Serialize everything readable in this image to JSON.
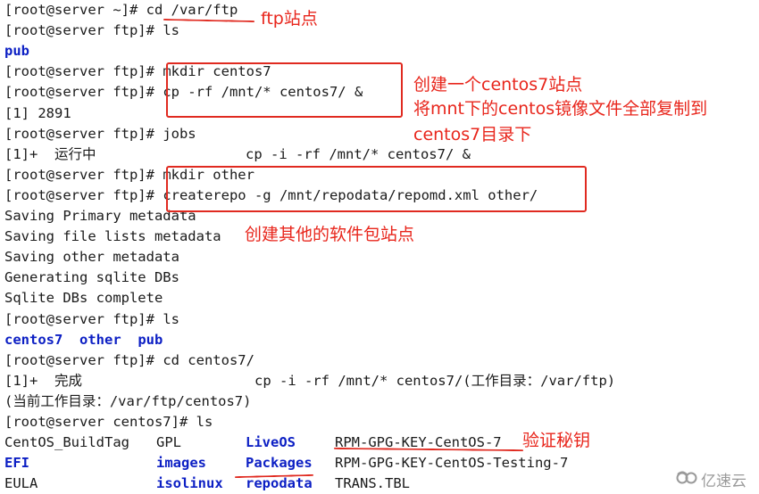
{
  "terminal": {
    "lines": [
      {
        "prompt": "[root@server ~]# ",
        "cmd": "cd /var/ftp"
      },
      {
        "prompt": "[root@server ftp]# ",
        "cmd": "ls"
      },
      {
        "output": "pub"
      },
      {
        "prompt": "[root@server ftp]# ",
        "cmd": "mkdir centos7"
      },
      {
        "prompt": "[root@server ftp]# ",
        "cmd": "cp -rf /mnt/* centos7/ &"
      },
      {
        "output": "[1] 2891"
      },
      {
        "prompt": "[root@server ftp]# ",
        "cmd": "jobs"
      },
      {
        "job_id": "[1]+  ",
        "job_state": "运行中",
        "job_cmd": "cp -i -rf /mnt/* centos7/ &"
      },
      {
        "prompt": "[root@server ftp]# ",
        "cmd": "mkdir other"
      },
      {
        "prompt": "[root@server ftp]# ",
        "cmd": "createrepo -g /mnt/repodata/repomd.xml other/"
      },
      {
        "output": "Saving Primary metadata"
      },
      {
        "output": "Saving file lists metadata"
      },
      {
        "output": "Saving other metadata"
      },
      {
        "output": "Generating sqlite DBs"
      },
      {
        "output": "Sqlite DBs complete"
      },
      {
        "prompt": "[root@server ftp]# ",
        "cmd": "ls"
      },
      {
        "dirs": [
          "centos7",
          "other",
          "pub"
        ]
      },
      {
        "prompt": "[root@server ftp]# ",
        "cmd": "cd centos7/"
      },
      {
        "job_id": "[1]+  ",
        "job_state": "完成",
        "job_cmd": "cp -i -rf /mnt/* centos7/(工作目录：/var/ftp)"
      },
      {
        "output": "(当前工作目录：/var/ftp/centos7)"
      },
      {
        "prompt": "[root@server centos7]# ",
        "cmd": "ls"
      }
    ],
    "listing": {
      "col1": [
        {
          "name": "CentOS_BuildTag",
          "dir": false
        },
        {
          "name": "EFI",
          "dir": true
        },
        {
          "name": "EULA",
          "dir": false
        }
      ],
      "col2": [
        {
          "name": "GPL",
          "dir": false
        },
        {
          "name": "images",
          "dir": true
        },
        {
          "name": "isolinux",
          "dir": true
        }
      ],
      "col3": [
        {
          "name": "LiveOS",
          "dir": true
        },
        {
          "name": "Packages",
          "dir": true
        },
        {
          "name": "repodata",
          "dir": true
        }
      ],
      "col4": [
        {
          "name": "RPM-GPG-KEY-CentOS-7",
          "dir": false
        },
        {
          "name": "RPM-GPG-KEY-CentOS-Testing-7",
          "dir": false
        },
        {
          "name": "TRANS.TBL",
          "dir": false
        }
      ]
    }
  },
  "annotations": {
    "ftp_site": "ftp站点",
    "create_centos7_1": "创建一个centos7站点",
    "create_centos7_2": "将mnt下的centos镜像文件全部复制到",
    "create_centos7_3": "centos7目录下",
    "create_other": "创建其他的软件包站点",
    "verify_key": "验证秘钥"
  },
  "colors": {
    "annotation_red": "#e8261c",
    "directory_blue": "#0c1fc4",
    "text": "#1a1a1a"
  },
  "watermark": {
    "icon": "cloud-logo-icon",
    "text": "亿速云"
  }
}
